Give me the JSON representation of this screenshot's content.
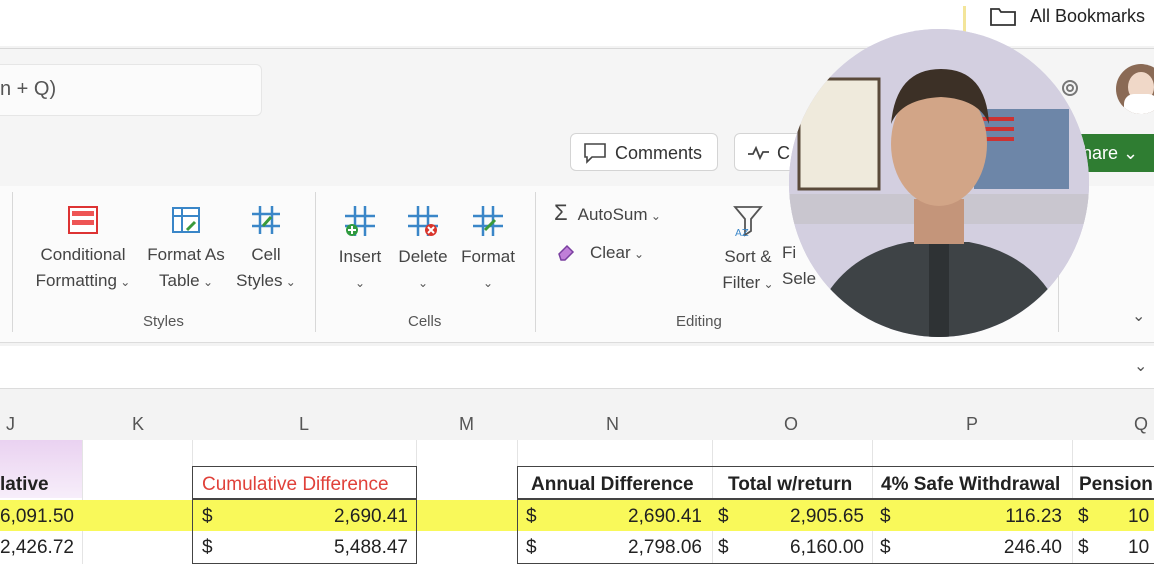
{
  "browser": {
    "bookmarks_label": "All Bookmarks"
  },
  "header": {
    "search_partial": "n + Q)",
    "comments_label": "Comments",
    "catchup_partial": "C",
    "share_partial": "hare"
  },
  "ribbon": {
    "styles": {
      "group_label": "Styles",
      "conditional_formatting": [
        "Conditional",
        "Formatting"
      ],
      "format_as_table": [
        "Format As",
        "Table"
      ],
      "cell_styles": [
        "Cell",
        "Styles"
      ]
    },
    "cells": {
      "group_label": "Cells",
      "insert": "Insert",
      "delete": "Delete",
      "format": "Format"
    },
    "editing": {
      "group_label": "Editing",
      "autosum": "AutoSum",
      "clear": "Clear",
      "sort_filter": [
        "Sort &",
        "Filter"
      ],
      "find_select_partial": [
        "Fi",
        "Sele"
      ]
    }
  },
  "columns": [
    "J",
    "K",
    "L",
    "M",
    "N",
    "O",
    "P",
    "Q"
  ],
  "sheet": {
    "j_header_partial": "lative",
    "j_values": [
      "6,091.50",
      "2,426.72"
    ],
    "cumulative_difference_header": "Cumulative Difference",
    "cumulative_values": [
      "2,690.41",
      "5,488.47"
    ],
    "table_headers": {
      "annual_difference": "Annual Difference",
      "total_w_return": "Total w/return",
      "safe_withdrawal": "4% Safe Withdrawal",
      "pension_partial": "Pension"
    },
    "currency_symbol": "$",
    "rows": [
      {
        "annual_difference": "2,690.41",
        "total_w_return": "2,905.65",
        "safe_withdrawal": "116.23",
        "pension_partial": "10"
      },
      {
        "annual_difference": "2,798.06",
        "total_w_return": "6,160.00",
        "safe_withdrawal": "246.40",
        "pension_partial": "10"
      }
    ]
  },
  "colors": {
    "highlight_row": "#f9f95a",
    "cumulative_header_text": "#e0413a",
    "share_button": "#2f7d32"
  }
}
